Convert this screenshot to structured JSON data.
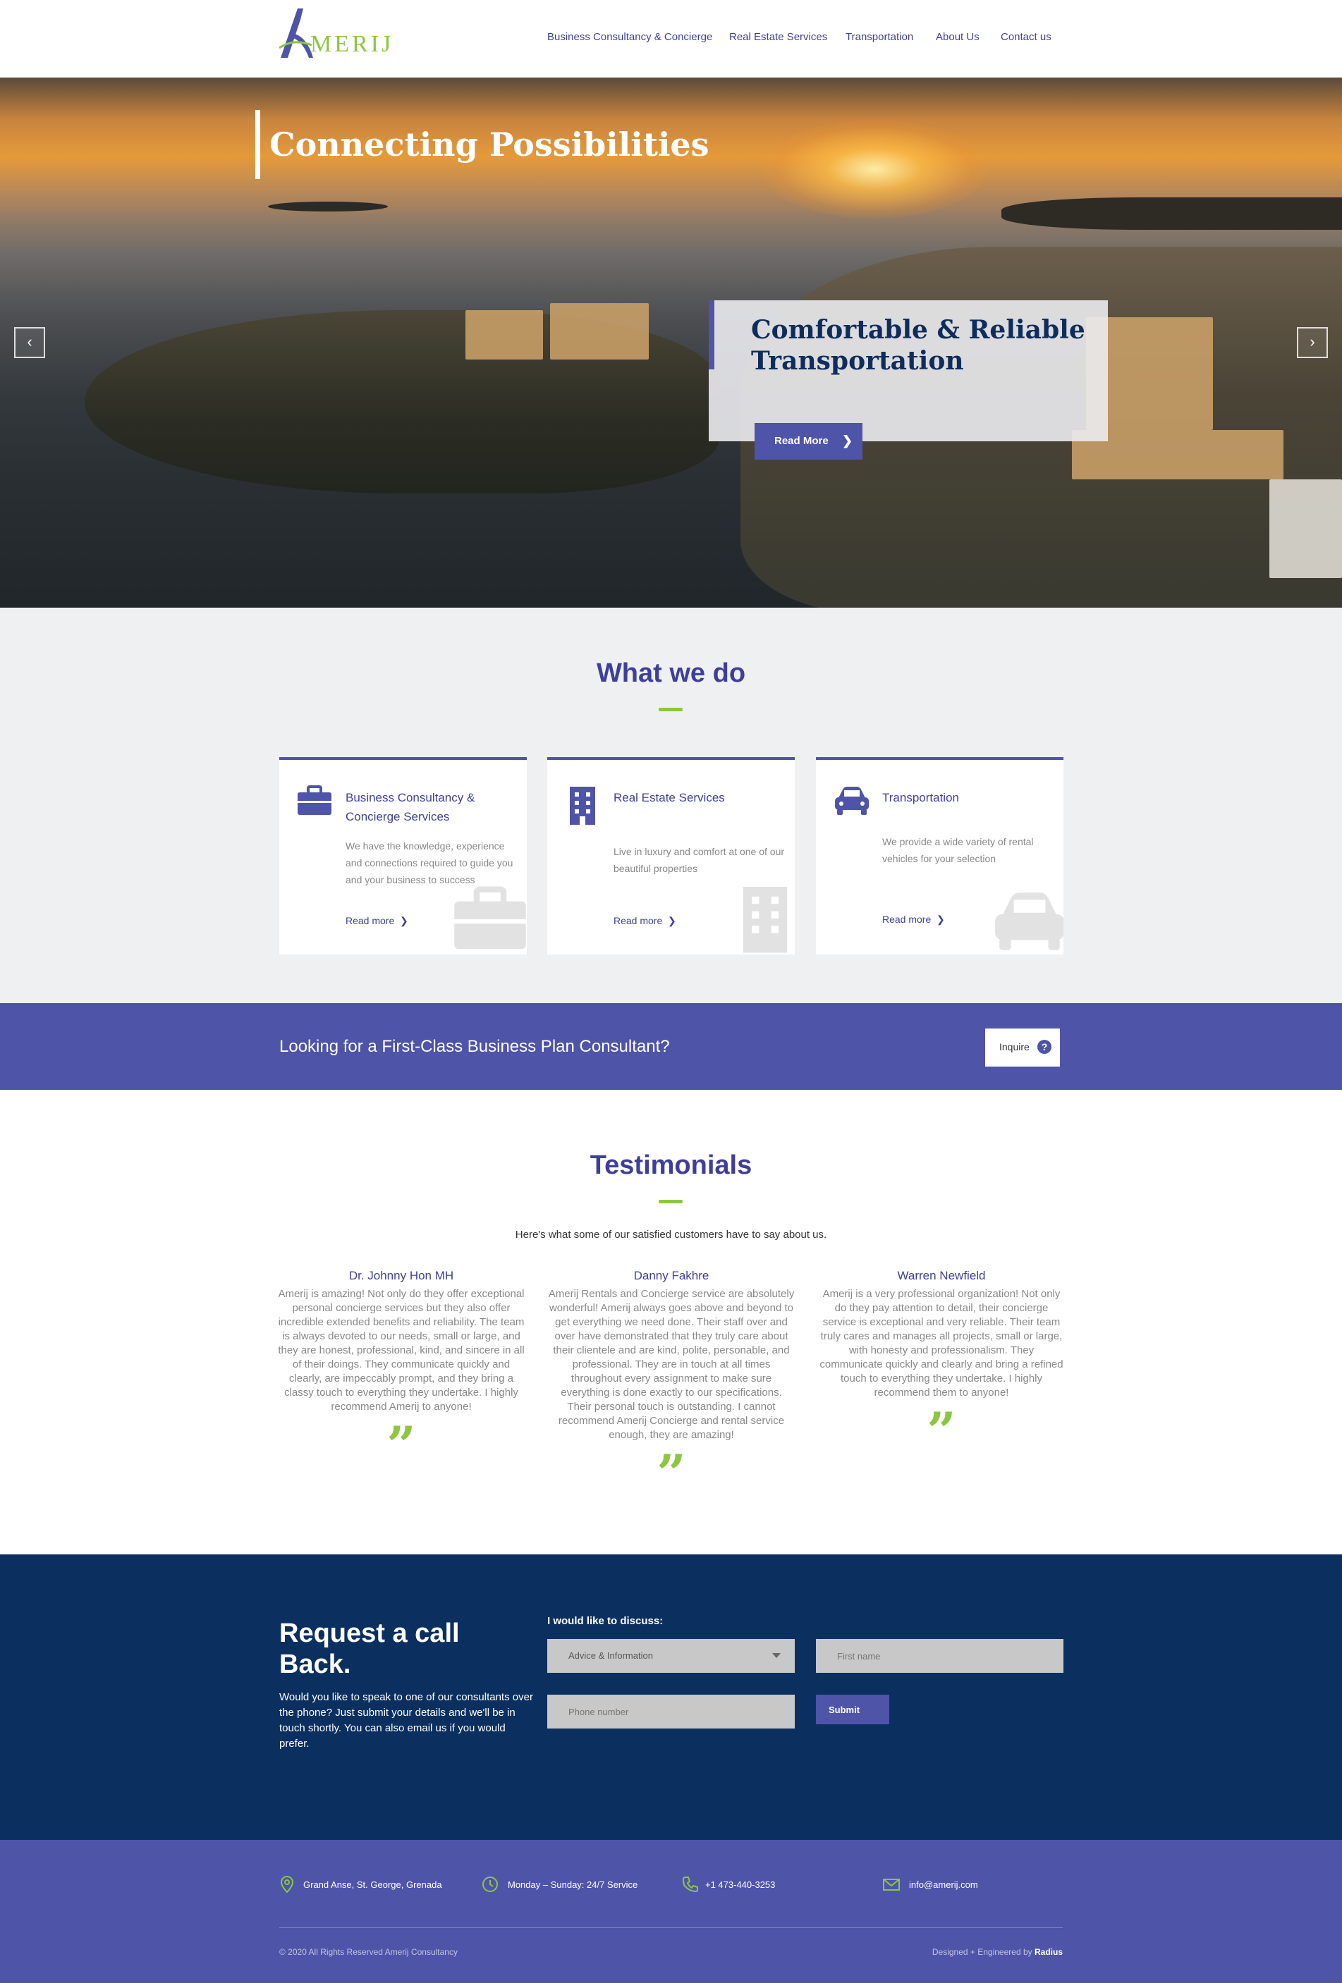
{
  "header": {
    "logo_text": "MERIJ",
    "nav": [
      {
        "label": "Business Consultancy & Concierge"
      },
      {
        "label": "Real Estate Services"
      },
      {
        "label": "Transportation"
      },
      {
        "label": "About Us"
      },
      {
        "label": "Contact us"
      }
    ]
  },
  "hero": {
    "title": "Connecting Possibilities",
    "slide_title": "Comfortable & Reliable Transportation",
    "button_label": "Read More",
    "prev_icon": "chevron-left-icon",
    "next_icon": "chevron-right-icon"
  },
  "whatwedo": {
    "title": "What we do",
    "cards": [
      {
        "title": "Business Consultancy & Concierge Services",
        "desc": "We have the knowledge, experience and connections required to guide you and your business to success",
        "more": "Read more",
        "icon": "briefcase-icon"
      },
      {
        "title": "Real Estate Services",
        "desc": "Live in luxury and comfort at one of our beautiful properties",
        "more": "Read more",
        "icon": "building-icon"
      },
      {
        "title": "Transportation",
        "desc": "We provide a wide variety of rental vehicles for your selection",
        "more": "Read more",
        "icon": "car-icon"
      }
    ]
  },
  "band": {
    "text": "Looking for a First-Class Business Plan Consultant?",
    "button_label": "Inquire",
    "button_icon": "question-circle-icon"
  },
  "testimonials": {
    "title": "Testimonials",
    "subtitle": "Here's what some of our satisfied customers have to say about us.",
    "items": [
      {
        "name": "Dr. Johnny Hon MH",
        "quote": "Amerij is amazing! Not only do they offer exceptional personal concierge services but they also offer incredible extended benefits and reliability. The team is always devoted to our needs, small or large, and they are honest, professional, kind, and sincere in all of their doings. They communicate quickly and clearly, are impeccably prompt, and they bring a classy touch to everything they undertake. I highly recommend Amerij to anyone!"
      },
      {
        "name": "Danny Fakhre",
        "quote": "Amerij Rentals and Concierge service are absolutely wonderful! Amerij always goes above and beyond to get everything we need done. Their staff over and over have demonstrated that they truly care about their clientele and are kind, polite, personable, and professional. They are in touch at all times throughout every assignment to make sure everything is done exactly to our specifications. Their personal touch is outstanding. I cannot recommend Amerij Concierge and rental service enough, they are amazing!"
      },
      {
        "name": "Warren Newfield",
        "quote": "Amerij is a very professional organization! Not only do they pay attention to detail, their concierge service is exceptional and very reliable. Their team truly cares and manages all projects, small or large, with honesty and professionalism. They communicate quickly and clearly and bring a refined touch to everything they undertake. I highly recommend them to anyone!"
      }
    ],
    "quote_mark": "”"
  },
  "callback": {
    "title": "Request a call Back.",
    "description": "Would you like to speak to one of our consultants over the phone? Just submit your details and we'll be in touch shortly. You can also email us if you would prefer.",
    "discuss_label": "I would like to discuss:",
    "discuss_value": "Advice & Information",
    "first_name_placeholder": "First name",
    "phone_placeholder": "Phone number",
    "submit_label": "Submit"
  },
  "footer": {
    "address": "Grand Anse, St. George, Grenada",
    "hours": "Monday – Sunday: 24/7 Service",
    "phone": "+1 473-440-3253",
    "email": "info@amerij.com",
    "copyright": "© 2020 All Rights Reserved Amerij Consultancy",
    "designed_prefix": "Designed + Engineered by",
    "designed_by": "Radius"
  },
  "colors": {
    "brand_purple": "#4e54a8",
    "brand_green": "#8dc63f",
    "navy": "#0b3060"
  }
}
